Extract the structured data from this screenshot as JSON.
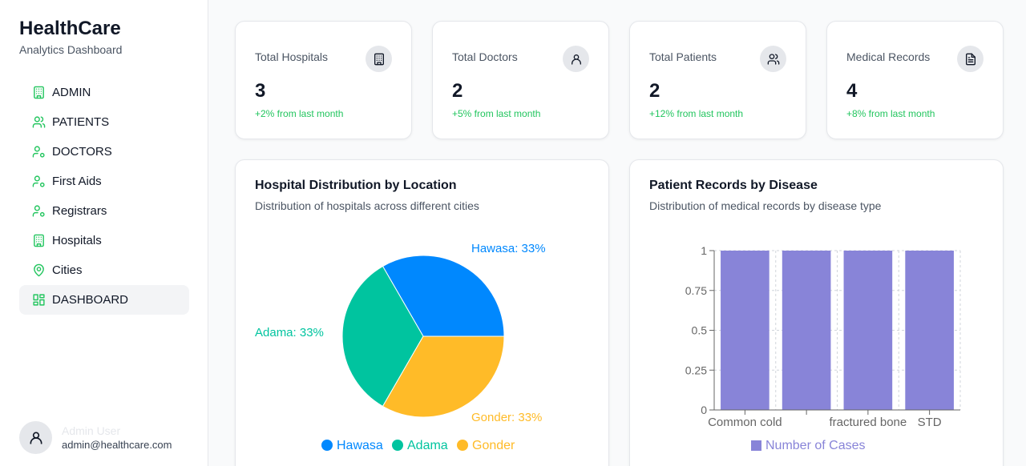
{
  "brand": {
    "title": "HealthCare",
    "subtitle": "Analytics Dashboard"
  },
  "nav": {
    "items": [
      {
        "label": "ADMIN",
        "icon": "building-icon"
      },
      {
        "label": "PATIENTS",
        "icon": "users-icon"
      },
      {
        "label": "DOCTORS",
        "icon": "user-cog-icon"
      },
      {
        "label": "First Aids",
        "icon": "user-cog-icon"
      },
      {
        "label": "Registrars",
        "icon": "user-cog-icon"
      },
      {
        "label": "Hospitals",
        "icon": "building-icon"
      },
      {
        "label": "Cities",
        "icon": "map-pin-icon"
      },
      {
        "label": "DASHBOARD",
        "icon": "layout-grid-icon"
      }
    ],
    "active": "DASHBOARD"
  },
  "user": {
    "name": "Admin User",
    "email": "admin@healthcare.com"
  },
  "stats": [
    {
      "label": "Total Hospitals",
      "value": "3",
      "change": "+2% from last month",
      "icon": "building-icon"
    },
    {
      "label": "Total Doctors",
      "value": "2",
      "change": "+5% from last month",
      "icon": "user-icon"
    },
    {
      "label": "Total Patients",
      "value": "2",
      "change": "+12% from last month",
      "icon": "users-icon"
    },
    {
      "label": "Medical Records",
      "value": "4",
      "change": "+8% from last month",
      "icon": "file-text-icon"
    }
  ],
  "charts": {
    "hospital": {
      "title": "Hospital Distribution by Location",
      "subtitle": "Distribution of hospitals across different cities"
    },
    "disease": {
      "title": "Patient Records by Disease",
      "subtitle": "Distribution of medical records by disease type"
    }
  },
  "colors": {
    "accent": "#22c55e",
    "hawasa": "#0088fe",
    "adama": "#00c49f",
    "gonder": "#ffbb28",
    "bar": "#8884d8"
  },
  "chart_data": [
    {
      "type": "pie",
      "categories": [
        "Hawasa",
        "Adama",
        "Gonder"
      ],
      "values": [
        1,
        1,
        1
      ],
      "slice_labels": [
        "Hawasa: 33%",
        "Adama: 33%",
        "Gonder: 33%"
      ],
      "colors": [
        "#0088fe",
        "#00c49f",
        "#ffbb28"
      ],
      "legend": "bottom"
    },
    {
      "type": "bar",
      "categories": [
        "Common cold",
        "",
        "fractured bone",
        "STD"
      ],
      "series": [
        {
          "name": "Number of Cases",
          "values": [
            1,
            1,
            1,
            1
          ]
        }
      ],
      "ylim": [
        0,
        1
      ],
      "yticks": [
        "0",
        "0.25",
        "0.5",
        "0.75",
        "1"
      ],
      "grid": true,
      "legend": "bottom",
      "color": "#8884d8"
    }
  ]
}
